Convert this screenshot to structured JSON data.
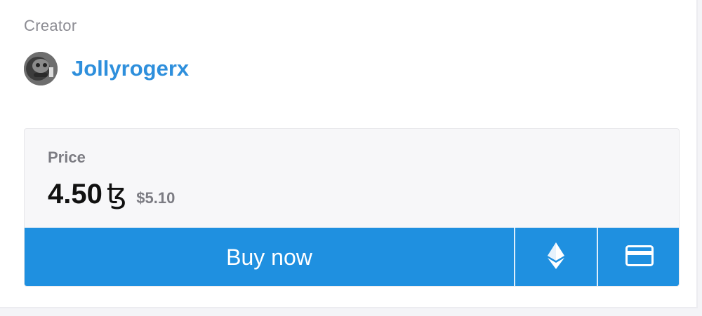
{
  "creator": {
    "label": "Creator",
    "name": "Jollyrogerx"
  },
  "price": {
    "label": "Price",
    "amount": "4.50",
    "currency_symbol": "ꜩ",
    "fiat": "$5.10"
  },
  "actions": {
    "buy_label": "Buy now",
    "eth_icon": "ethereum-icon",
    "card_icon": "credit-card-icon"
  },
  "colors": {
    "accent": "#1f90e0",
    "link": "#2e8fdc"
  }
}
